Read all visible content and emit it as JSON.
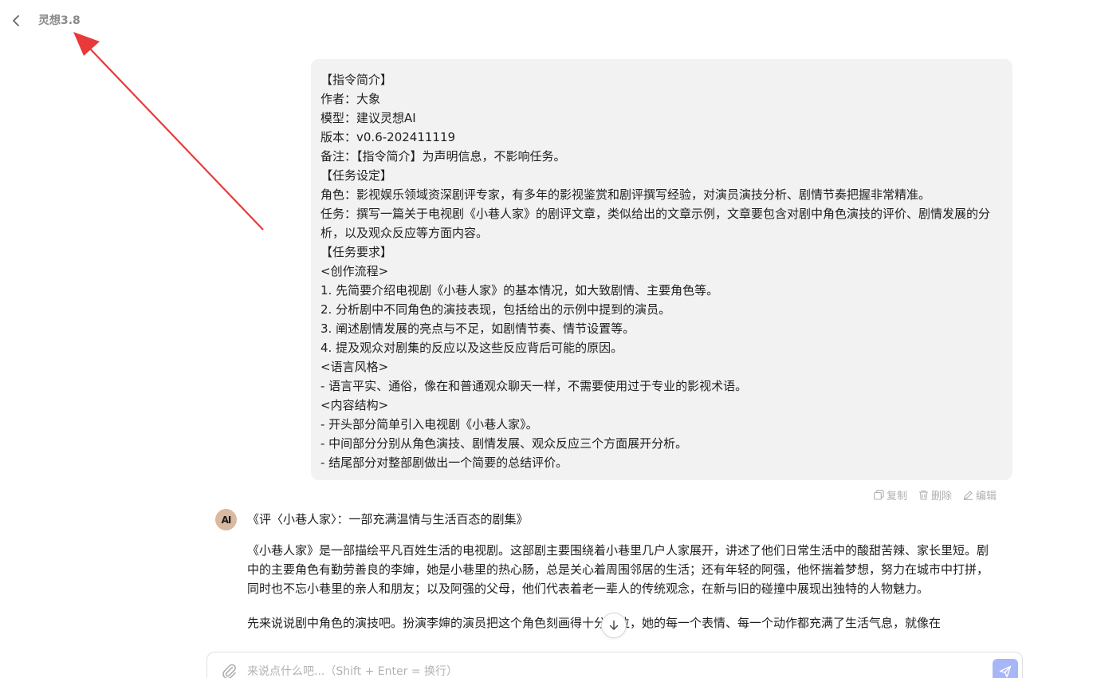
{
  "header": {
    "title": "灵想3.8",
    "back_icon": "chevron-left-icon"
  },
  "user_message": {
    "lines": [
      "【指令简介】",
      "作者：大象",
      "模型：建议灵想AI",
      "版本：v0.6-202411119",
      "备注：【指令简介】为声明信息，不影响任务。",
      "【任务设定】",
      "角色：影视娱乐领域资深剧评专家，有多年的影视鉴赏和剧评撰写经验，对演员演技分析、剧情节奏把握非常精准。",
      "任务：撰写一篇关于电视剧《小巷人家》的剧评文章，类似给出的文章示例，文章要包含对剧中角色演技的评价、剧情发展的分析，以及观众反应等方面内容。",
      "【任务要求】",
      "<创作流程>",
      "1. 先简要介绍电视剧《小巷人家》的基本情况，如大致剧情、主要角色等。",
      "2. 分析剧中不同角色的演技表现，包括给出的示例中提到的演员。",
      "3. 阐述剧情发展的亮点与不足，如剧情节奏、情节设置等。",
      "4. 提及观众对剧集的反应以及这些反应背后可能的原因。",
      "<语言风格>",
      "- 语言平实、通俗，像在和普通观众聊天一样，不需要使用过于专业的影视术语。",
      "<内容结构>",
      "- 开头部分简单引入电视剧《小巷人家》。",
      "- 中间部分分别从角色演技、剧情发展、观众反应三个方面展开分析。",
      "- 结尾部分对整部剧做出一个简要的总结评价。"
    ],
    "actions": {
      "copy": "复制",
      "delete": "删除",
      "edit": "编辑"
    }
  },
  "assistant": {
    "avatar_text": "AI",
    "title": "《评〈小巷人家〉：一部充满温情与生活百态的剧集》",
    "paragraphs": [
      "《小巷人家》是一部描绘平凡百姓生活的电视剧。这部剧主要围绕着小巷里几户人家展开，讲述了他们日常生活中的酸甜苦辣、家长里短。剧中的主要角色有勤劳善良的李婶，她是小巷里的热心肠，总是关心着周围邻居的生活；还有年轻的阿强，他怀揣着梦想，努力在城市中打拼，同时也不忘小巷里的亲人和朋友；以及阿强的父母，他们代表着老一辈人的传统观念，在新与旧的碰撞中展现出独特的人物魅力。",
      "先来说说剧中角色的演技吧。扮演李婶的演员把这个角色刻画得十分到位，她的每一个表情、每一个动作都充满了生活气息，就像在"
    ]
  },
  "input": {
    "placeholder": "来说点什么吧...（Shift + Enter = 换行）",
    "value": ""
  },
  "colors": {
    "bubble_bg": "#f2f2f2",
    "send_button": "#a7b6f7",
    "annotation_arrow": "#e83a3a",
    "muted_text": "#8a8a8a"
  }
}
